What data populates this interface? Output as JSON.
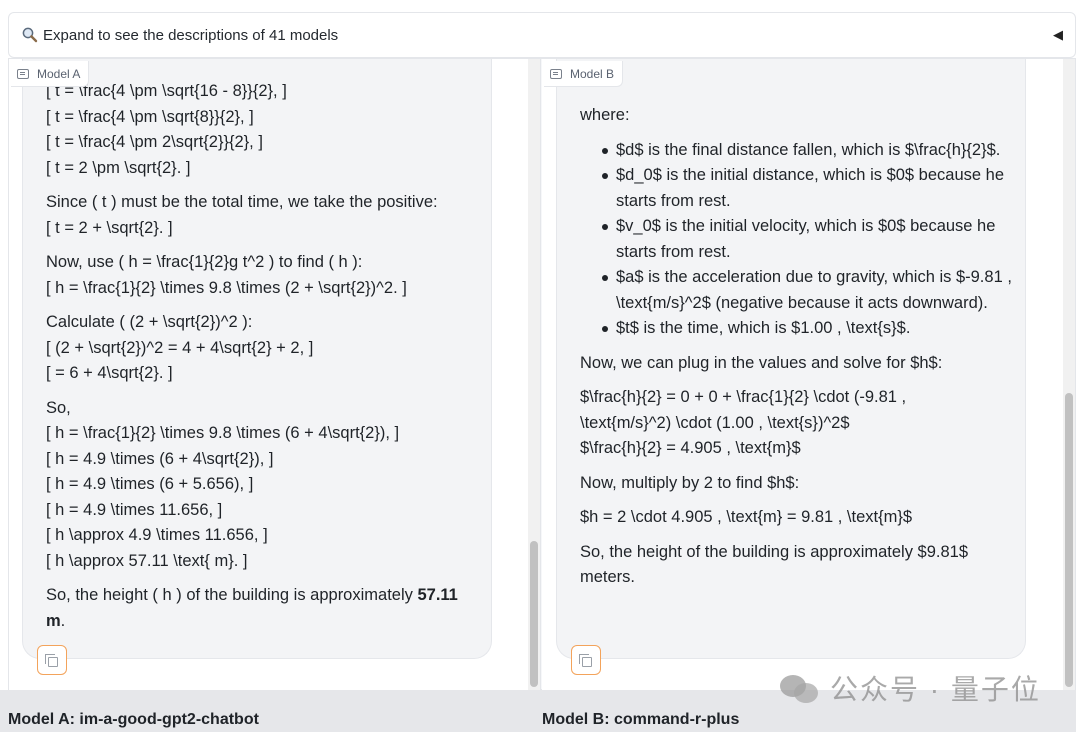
{
  "accordion": {
    "label": "Expand to see the descriptions of 41 models",
    "search_icon": "search-icon",
    "toggle_icon": "caret-left-icon"
  },
  "panel_a": {
    "tag": "Model A",
    "content": [
      {
        "lines": [
          "[ t = \\frac{4 \\pm \\sqrt{16 - 8}}{2}, ]",
          "[ t = \\frac{4 \\pm \\sqrt{8}}{2}, ]",
          "[ t = \\frac{4 \\pm 2\\sqrt{2}}{2}, ]",
          "[ t = 2 \\pm \\sqrt{2}. ]"
        ]
      },
      {
        "lines": [
          "Since ( t ) must be the total time, we take the positive:",
          "[ t = 2 + \\sqrt{2}. ]"
        ]
      },
      {
        "lines": [
          "Now, use ( h = \\frac{1}{2}g t^2 ) to find ( h ):",
          "[ h = \\frac{1}{2} \\times 9.8 \\times (2 + \\sqrt{2})^2. ]"
        ]
      },
      {
        "lines": [
          "Calculate ( (2 + \\sqrt{2})^2 ):",
          "[ (2 + \\sqrt{2})^2 = 4 + 4\\sqrt{2} + 2, ]",
          "[ = 6 + 4\\sqrt{2}. ]"
        ]
      },
      {
        "lines": [
          "So,",
          "[ h = \\frac{1}{2} \\times 9.8 \\times (6 + 4\\sqrt{2}), ]",
          "[ h = 4.9 \\times (6 + 4\\sqrt{2}), ]",
          "[ h = 4.9 \\times (6 + 5.656), ]",
          "[ h = 4.9 \\times 11.656, ]",
          "[ h \\approx 4.9 \\times 11.656, ]",
          "[ h \\approx 57.11 \\text{ m}. ]"
        ]
      }
    ],
    "conclusion": {
      "text": "So, the height ( h ) of the building is approximately",
      "bold": "57.11 m",
      "end": "."
    },
    "copy_icon": "copy-icon"
  },
  "panel_b": {
    "tag": "Model B",
    "where": "where:",
    "bullets": [
      "$d$ is the final distance fallen, which is $\\frac{h}{2}$.",
      "$d_0$ is the initial distance, which is $0$ because he starts from rest.",
      "$v_0$ is the initial velocity, which is $0$ because he starts from rest.",
      "$a$ is the acceleration due to gravity, which is $-9.81 , \\text{m/s}^2$ (negative because it acts downward).",
      "$t$ is the time, which is $1.00 , \\text{s}$."
    ],
    "plug": "Now, we can plug in the values and solve for $h$:",
    "eq_lines": [
      "$\\frac{h}{2} = 0 + 0 + \\frac{1}{2} \\cdot (-9.81 ,",
      "\\text{m/s}^2) \\cdot (1.00 , \\text{s})^2$",
      "$\\frac{h}{2} = 4.905 , \\text{m}$"
    ],
    "multiply": "Now, multiply by 2 to find $h$:",
    "result": "$h = 2 \\cdot 4.905 , \\text{m} = 9.81 , \\text{m}$",
    "conclusion": "So, the height of the building is approximately $9.81$ meters.",
    "copy_icon": "copy-icon"
  },
  "footer": {
    "model_a": "Model A: im-a-good-gpt2-chatbot",
    "model_b": "Model B: command-r-plus"
  },
  "watermark": {
    "text": "公众号 · 量子位",
    "icon": "wechat-icon"
  },
  "colors": {
    "accent": "#f3a35b",
    "bubble": "#f3f4f6",
    "footer": "#e6e7ea"
  }
}
